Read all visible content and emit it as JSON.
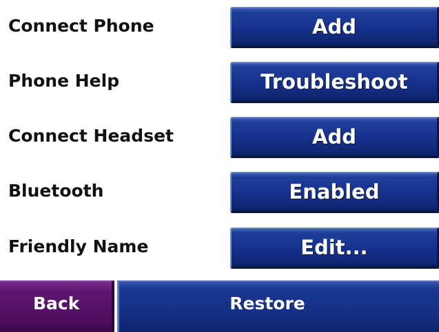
{
  "settings": {
    "rows": [
      {
        "label": "Connect Phone",
        "button": "Add"
      },
      {
        "label": "Phone Help",
        "button": "Troubleshoot"
      },
      {
        "label": "Connect Headset",
        "button": "Add"
      },
      {
        "label": "Bluetooth",
        "button": "Enabled"
      },
      {
        "label": "Friendly Name",
        "button": "Edit..."
      }
    ]
  },
  "footer": {
    "back_label": "Back",
    "restore_label": "Restore"
  },
  "colors": {
    "button_blue": "#15308a",
    "back_purple": "#5f1570",
    "label_text": "#111111",
    "background": "#ffffff"
  }
}
